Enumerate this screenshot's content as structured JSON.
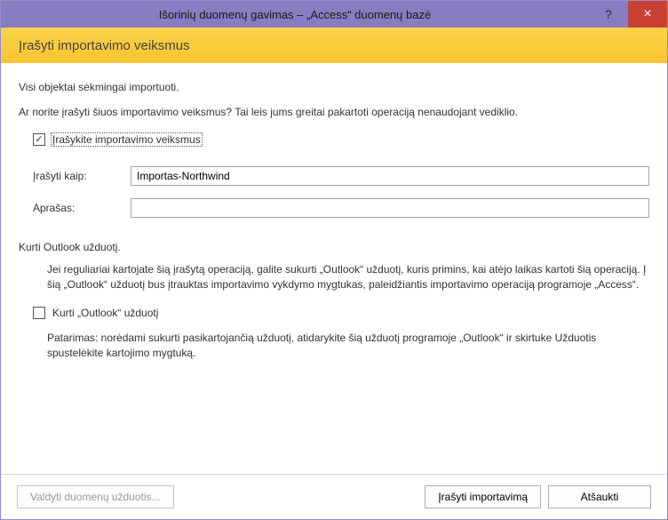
{
  "titlebar": {
    "title": "Išorinių duomenų gavimas – „Access“ duomenų bazė",
    "help_tooltip": "?",
    "close_tooltip": "×"
  },
  "heading": "Įrašyti importavimo veiksmus",
  "status_message": "Visi objektai sėkmingai importuoti.",
  "question": "Ar norite įrašyti šiuos importavimo veiksmus? Tai leis jums greitai pakartoti operaciją nenaudojant vediklio.",
  "save_steps_checkbox": {
    "label": "Įrašykite importavimo veiksmus",
    "checked": true
  },
  "form": {
    "save_as_label": "Įrašyti kaip:",
    "save_as_value": "Importas-Northwind",
    "description_label": "Aprašas:",
    "description_value": ""
  },
  "outlook": {
    "section_title": "Kurti Outlook užduotį.",
    "body": "Jei reguliariai kartojate šią įrašytą operaciją, galite sukurti „Outlook“ užduotį, kuris primins, kai atėjo laikas kartoti šią operaciją. Į šią „Outlook“ užduotį bus įtrauktas importavimo vykdymo mygtukas, paleidžiantis importavimo operaciją programoje „Access“.",
    "checkbox_label": "Kurti „Outlook“ užduotį",
    "checkbox_checked": false,
    "tip": "Patarimas: norėdami sukurti pasikartojančią užduotį, atidarykite šią užduotį programoje „Outlook“ ir skirtuke Užduotis spustelėkite kartojimo mygtuką."
  },
  "buttons": {
    "manage": "Valdyti duomenų užduotis...",
    "save": "Įrašyti importavimą",
    "cancel": "Atšaukti"
  }
}
